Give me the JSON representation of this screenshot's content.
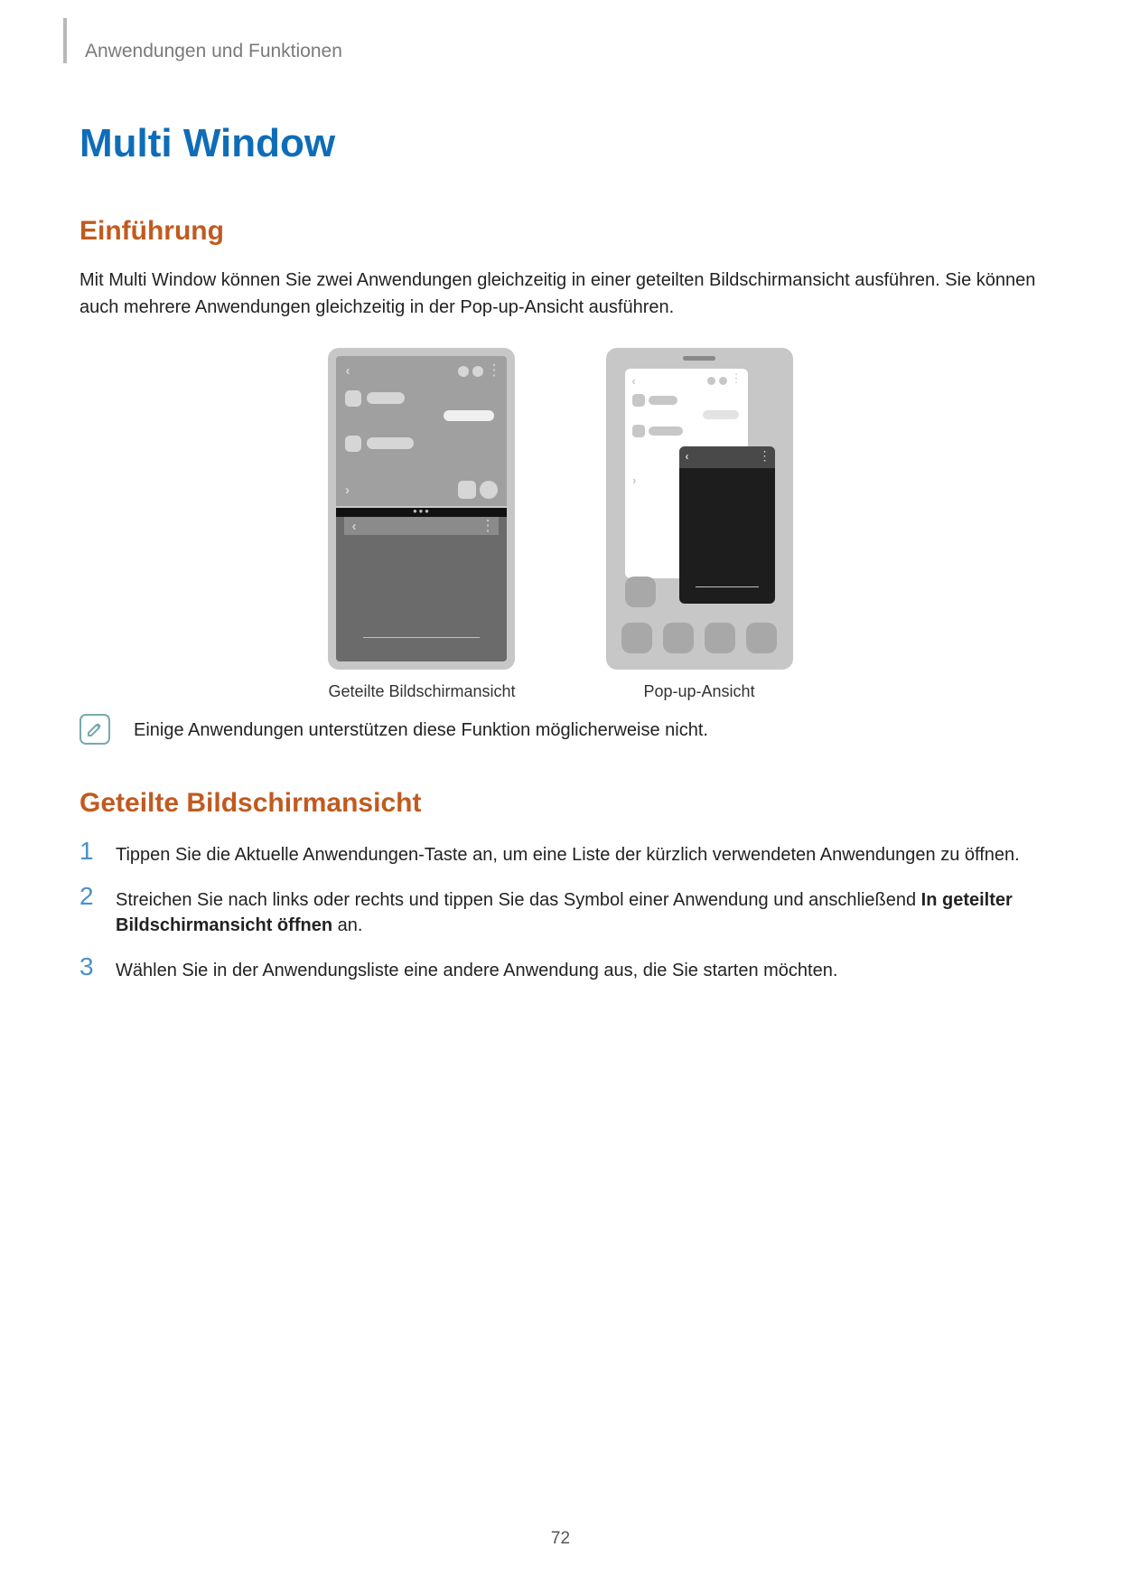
{
  "breadcrumb": "Anwendungen und Funktionen",
  "h1": "Multi Window",
  "intro_heading": "Einführung",
  "intro_body": "Mit Multi Window können Sie zwei Anwendungen gleichzeitig in einer geteilten Bildschirmansicht ausführen. Sie können auch mehrere Anwendungen gleichzeitig in der Pop-up-Ansicht ausführen.",
  "figure1_caption": "Geteilte Bildschirmansicht",
  "figure2_caption": "Pop-up-Ansicht",
  "note_text": "Einige Anwendungen unterstützen diese Funktion möglicherweise nicht.",
  "section2_heading": "Geteilte Bildschirmansicht",
  "steps": [
    {
      "n": "1",
      "text": "Tippen Sie die Aktuelle Anwendungen-Taste an, um eine Liste der kürzlich verwendeten Anwendungen zu öffnen."
    },
    {
      "n": "2",
      "text_pre": "Streichen Sie nach links oder rechts und tippen Sie das Symbol einer Anwendung und anschließend ",
      "bold": "In geteilter Bildschirmansicht öffnen",
      "text_post": " an."
    },
    {
      "n": "3",
      "text": "Wählen Sie in der Anwendungsliste eine andere Anwendung aus, die Sie starten möchten."
    }
  ],
  "page_number": "72"
}
